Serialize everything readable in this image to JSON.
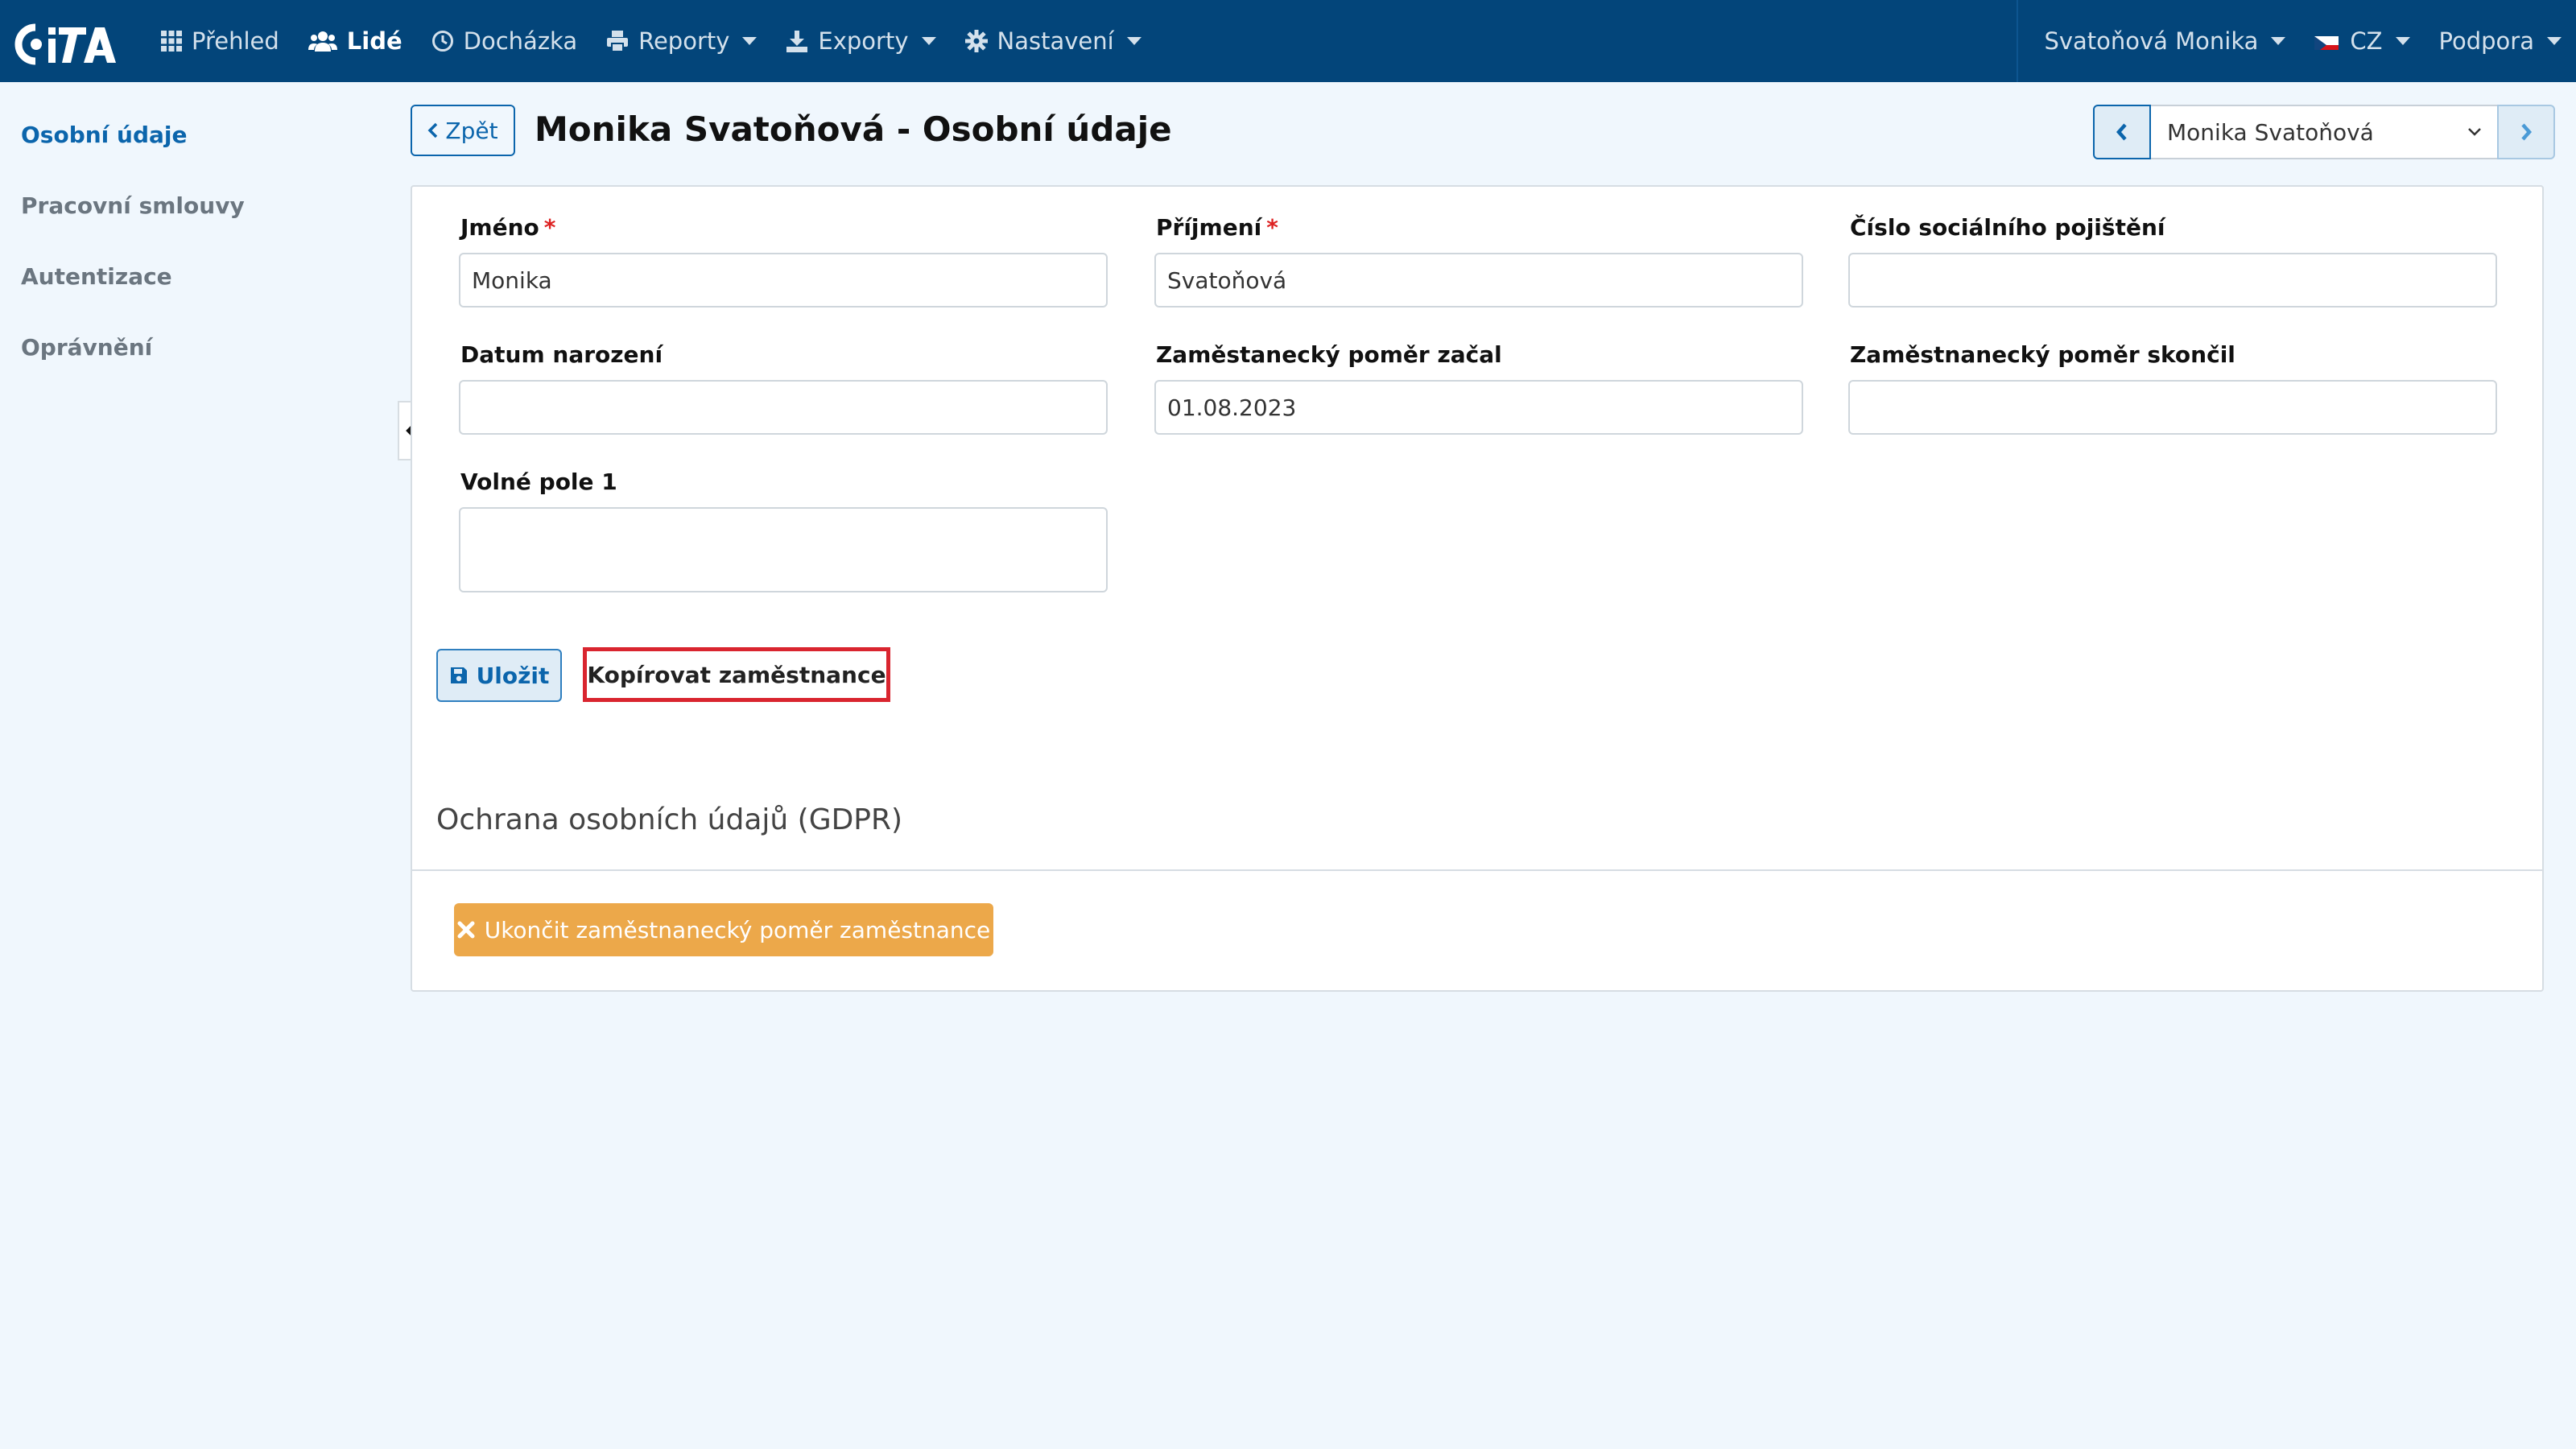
{
  "app": {
    "logo_text": "CiTA"
  },
  "nav": {
    "items": [
      {
        "label": "Přehled",
        "icon": "grid-icon"
      },
      {
        "label": "Lidé",
        "icon": "users-icon"
      },
      {
        "label": "Docházka",
        "icon": "clock-icon"
      },
      {
        "label": "Reporty",
        "icon": "print-icon"
      },
      {
        "label": "Exporty",
        "icon": "export-icon"
      },
      {
        "label": "Nastavení",
        "icon": "gear-icon"
      }
    ],
    "user": "Svatoňová Monika",
    "language": "CZ",
    "support": "Podpora"
  },
  "sidebar": {
    "items": [
      {
        "label": "Osobní údaje"
      },
      {
        "label": "Pracovní smlouvy"
      },
      {
        "label": "Autentizace"
      },
      {
        "label": "Oprávnění"
      }
    ]
  },
  "header": {
    "back_label": "Zpět",
    "title": "Monika Svatoňová - Osobní údaje",
    "employee_select": "Monika Svatoňová"
  },
  "form": {
    "first_name": {
      "label": "Jméno",
      "required": "*",
      "value": "Monika"
    },
    "last_name": {
      "label": "Příjmení",
      "required": "*",
      "value": "Svatoňová"
    },
    "social_insurance": {
      "label": "Číslo sociálního pojištění",
      "value": ""
    },
    "birth_date": {
      "label": "Datum narození",
      "value": ""
    },
    "employment_start": {
      "label": "Zaměstanecký poměr začal",
      "value": "01.08.2023"
    },
    "employment_end": {
      "label": "Zaměstnanecký poměr skončil",
      "value": ""
    },
    "free_field_1": {
      "label": "Volné pole 1",
      "value": ""
    }
  },
  "actions": {
    "save_label": "Uložit",
    "copy_label": "Kopírovat zaměstnance"
  },
  "gdpr": {
    "title": "Ochrana osobních údajů (GDPR)",
    "end_label": "Ukončit zaměstnanecký poměr zaměstnance"
  },
  "colors": {
    "navbar": "#03457a",
    "accent": "#0b65ac",
    "warning": "#eca84a",
    "highlight": "#d9252f",
    "background": "#f0f7fd"
  }
}
